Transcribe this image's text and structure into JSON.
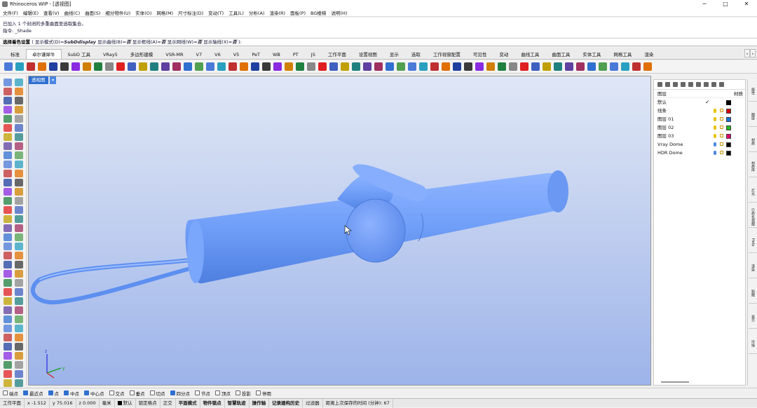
{
  "window": {
    "title": "Rhinoceros WIP - [透视图]"
  },
  "menu": [
    "文件(F)",
    "编辑(E)",
    "查看(V)",
    "曲线(C)",
    "曲面(S)",
    "细分物件(U)",
    "实体(O)",
    "网格(M)",
    "尺寸标注(D)",
    "变动(T)",
    "工具(L)",
    "分析(A)",
    "渲染(R)",
    "面板(P)",
    "BG楼梯",
    "说明(H)"
  ],
  "history": {
    "line1": "已加入 1 个封闭的多重曲面至选取集合。",
    "line2": "指令: _Shade"
  },
  "prompt": {
    "label": "选择着色设置",
    "opt1": "( 显示模式(D)=",
    "val1": "SubDdisplay",
    "opt2": " 显示曲线(B)=",
    "val2": "否",
    "opt3": " 显示框线(A)=",
    "val3": "否",
    "opt4": " 显示网线(W)=",
    "val4": "否",
    "opt5": " 显示轴线(X)=",
    "val5": "否",
    "end": " ):"
  },
  "tabs": [
    "标准",
    "卓尔谦犀牛",
    "SubD 工具",
    "VRay5",
    "多边形建模",
    "VSR-MR",
    "V7",
    "V6",
    "V5",
    "PeT",
    "WB",
    "PT",
    "JS",
    "工作平面",
    "设置视图",
    "显示",
    "选取",
    "工作视窗配置",
    "可见性",
    "变动",
    "曲线工具",
    "曲面工具",
    "实体工具",
    "网格工具",
    "渲染"
  ],
  "viewport": {
    "label": "透视图"
  },
  "layers": {
    "header_name": "图层",
    "header_material": "材质",
    "rows": [
      {
        "name": "默认",
        "current": true,
        "color": "#000000"
      },
      {
        "name": "线条",
        "color": "#d40000"
      },
      {
        "name": "图层 01",
        "color": "#1a6fd6"
      },
      {
        "name": "图层 02",
        "color": "#22bb22"
      },
      {
        "name": "图层 03",
        "color": "#e0006a"
      },
      {
        "name": "Vray Dome",
        "color": "#000000"
      },
      {
        "name": "HDR Dome",
        "color": "#000000"
      }
    ]
  },
  "right_tabs": [
    "属性",
    "图层",
    "材质",
    "材质库",
    "灯光",
    "已命名视图",
    "Help",
    "渲染",
    "贴图",
    "显示",
    "环境"
  ],
  "osnap": [
    {
      "label": "端点",
      "on": false
    },
    {
      "label": "最近点",
      "on": true
    },
    {
      "label": "点",
      "on": true
    },
    {
      "label": "中点",
      "on": true
    },
    {
      "label": "中心点",
      "on": true
    },
    {
      "label": "交点",
      "on": false
    },
    {
      "label": "垂点",
      "on": false
    },
    {
      "label": "切点",
      "on": false
    },
    {
      "label": "四分点",
      "on": true
    },
    {
      "label": "节点",
      "on": false
    },
    {
      "label": "顶点",
      "on": false
    },
    {
      "label": "投影",
      "on": false
    },
    {
      "label": "停用",
      "on": false
    }
  ],
  "status": {
    "cplane": "工作平面",
    "x": "x -1.512",
    "y": "y 75.016",
    "z": "z 0.000",
    "unit": "毫米",
    "layer": "默认",
    "items": [
      "锁定格点",
      "正交",
      "平面模式",
      "物件锁点",
      "智慧轨迹",
      "操作轴",
      "记录建构历史",
      "过滤器",
      "距离上次保存的时间 (分钟): 67"
    ]
  },
  "model_color": "#6f9ef8"
}
